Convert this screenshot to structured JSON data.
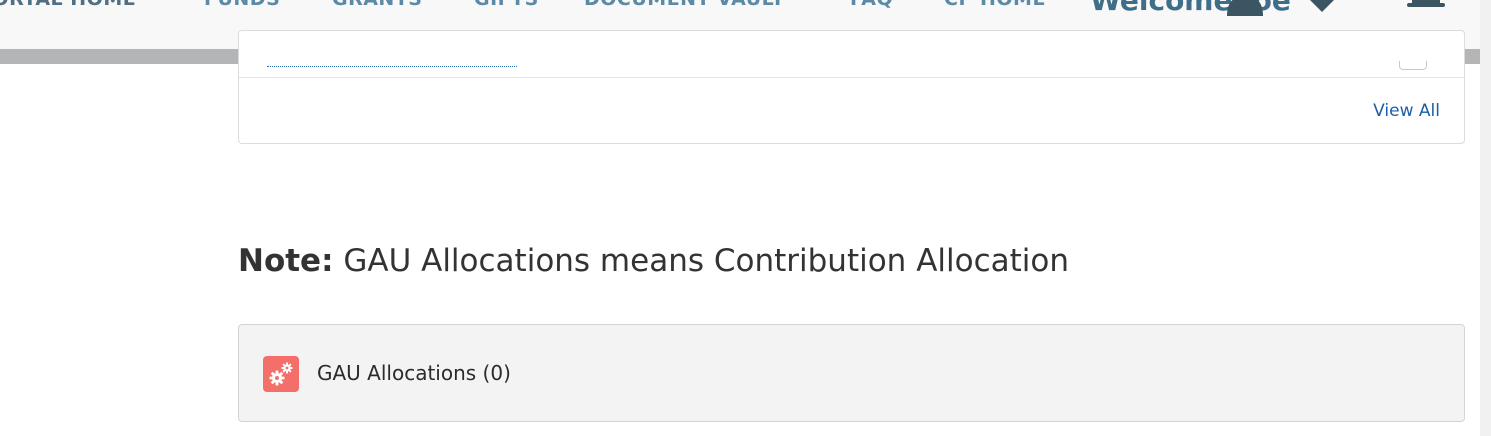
{
  "nav": {
    "items": [
      "PORTAL HOME",
      "FUNDS",
      "GRANTS",
      "GIFTS",
      "DOCUMENT VAULT",
      "FAQ",
      "CP HOME"
    ],
    "welcome": "Welcome Joe",
    "icons": [
      "user-icon",
      "chevron-down-icon",
      "bell-icon"
    ]
  },
  "card": {
    "view_all": "View All"
  },
  "note": {
    "label": "Note:",
    "text": " GAU Allocations means Contribution Allocation"
  },
  "gau": {
    "title": "GAU Allocations (0)",
    "icon": "gears-icon",
    "icon_color": "#f46f6a"
  },
  "colors": {
    "nav_text": "#5b8aa6",
    "link": "#1a5ea8"
  }
}
